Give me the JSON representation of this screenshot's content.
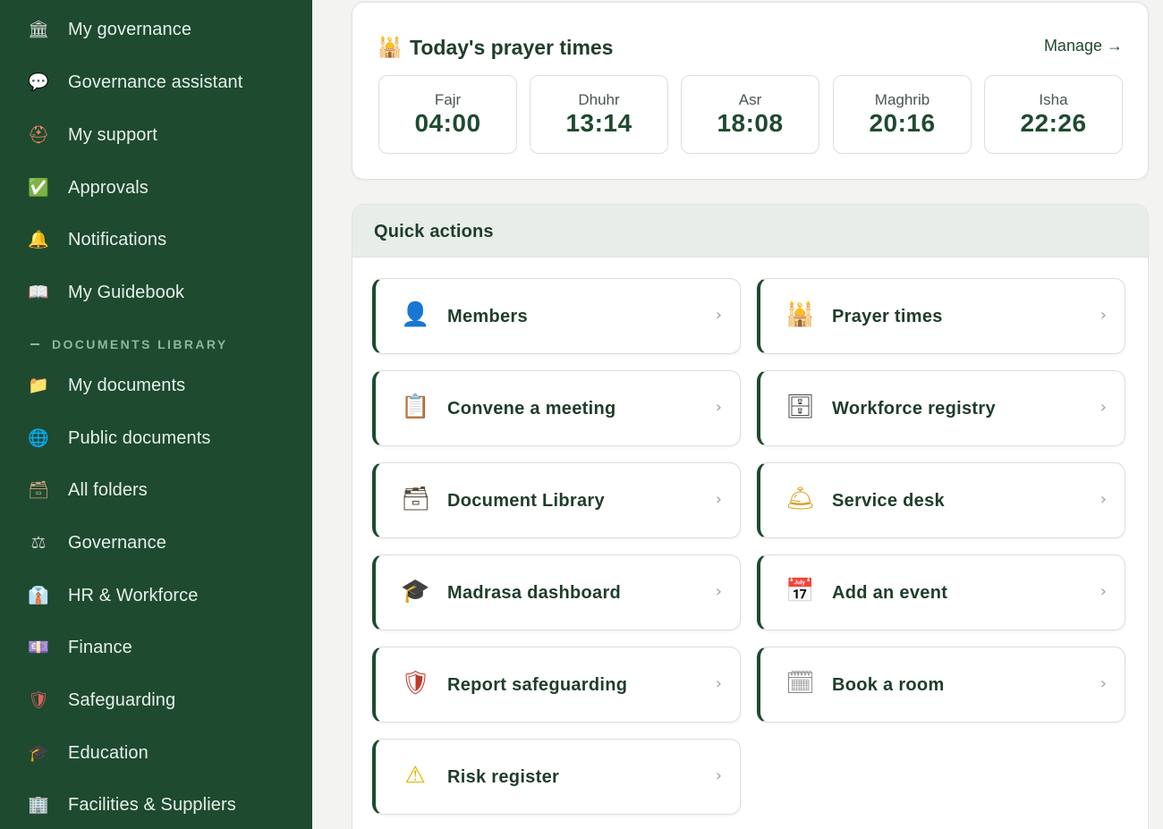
{
  "sidebar": {
    "items": [
      {
        "label": "My governance",
        "icon": "bank-icon",
        "glyph": "🏛",
        "color": "#d9d9d9"
      },
      {
        "label": "Governance assistant",
        "icon": "speech-bubble-icon",
        "glyph": "💬",
        "color": "#ffffff"
      },
      {
        "label": "My support",
        "icon": "lifebuoy-icon",
        "glyph": "⛑",
        "color": "#ff8a65"
      },
      {
        "label": "Approvals",
        "icon": "check-box-icon",
        "glyph": "✅",
        "color": "#2ec25b"
      },
      {
        "label": "Notifications",
        "icon": "bell-icon",
        "glyph": "🔔",
        "color": "#f4c542"
      },
      {
        "label": "My Guidebook",
        "icon": "open-book-icon",
        "glyph": "📖",
        "color": "#e8eef5"
      }
    ],
    "section_title": "DOCUMENTS LIBRARY",
    "doc_items": [
      {
        "label": "My documents",
        "icon": "folder-icon",
        "glyph": "📁",
        "color": "#c9c9c9"
      },
      {
        "label": "Public documents",
        "icon": "globe-icon",
        "glyph": "🌐",
        "color": "#7cb8e6"
      },
      {
        "label": "All folders",
        "icon": "card-index-icon",
        "glyph": "🗃",
        "color": "#c9a27a"
      },
      {
        "label": "Governance",
        "icon": "scales-icon",
        "glyph": "⚖",
        "color": "#c0c8c2"
      },
      {
        "label": "HR & Workforce",
        "icon": "briefcase-icon",
        "glyph": "👔",
        "color": "#7aa7e0"
      },
      {
        "label": "Finance",
        "icon": "banknote-icon",
        "glyph": "💷",
        "color": "#e0b4c8"
      },
      {
        "label": "Safeguarding",
        "icon": "shield-icon",
        "glyph": "🛡",
        "color": "#e06060"
      },
      {
        "label": "Education",
        "icon": "graduation-cap-icon",
        "glyph": "🎓",
        "color": "#d9a040"
      },
      {
        "label": "Facilities & Suppliers",
        "icon": "office-building-icon",
        "glyph": "🏢",
        "color": "#c0c4c8"
      }
    ]
  },
  "prayer": {
    "title": "Today's prayer times",
    "icon": "mosque-icon",
    "manage_label": "Manage →",
    "slots": [
      {
        "name": "Fajr",
        "time": "04:00"
      },
      {
        "name": "Dhuhr",
        "time": "13:14"
      },
      {
        "name": "Asr",
        "time": "18:08"
      },
      {
        "name": "Maghrib",
        "time": "20:16"
      },
      {
        "name": "Isha",
        "time": "22:26"
      }
    ]
  },
  "quick_actions": {
    "title": "Quick actions",
    "chevron": "›",
    "items": [
      {
        "label": "Members",
        "icon": "person-silhouette-icon",
        "glyph": "👤",
        "color": "#3d6e9e"
      },
      {
        "label": "Prayer times",
        "icon": "mosque-icon",
        "glyph": "🕌",
        "color": "#c8873a"
      },
      {
        "label": "Convene a meeting",
        "icon": "clipboard-icon",
        "glyph": "📋",
        "color": "#b08a5a"
      },
      {
        "label": "Workforce registry",
        "icon": "filing-tray-icon",
        "glyph": "🗄",
        "color": "#4a4a4a"
      },
      {
        "label": "Document Library",
        "icon": "card-file-box-icon",
        "glyph": "🗃",
        "color": "#5a4a3a"
      },
      {
        "label": "Service desk",
        "icon": "bellhop-bell-icon",
        "glyph": "🛎",
        "color": "#d9a020"
      },
      {
        "label": "Madrasa dashboard",
        "icon": "graduation-cap-icon",
        "glyph": "🎓",
        "color": "#222222"
      },
      {
        "label": "Add an event",
        "icon": "calendar-icon",
        "glyph": "📅",
        "color": "#c0392b"
      },
      {
        "label": "Report safeguarding",
        "icon": "shield-icon",
        "glyph": "🛡",
        "color": "#c0392b"
      },
      {
        "label": "Book a room",
        "icon": "spiral-calendar-icon",
        "glyph": "🗓",
        "color": "#888888"
      },
      {
        "label": "Risk register",
        "icon": "warning-icon",
        "glyph": "⚠",
        "color": "#e0b400"
      }
    ]
  },
  "colors": {
    "sidebar_bg": "#1e4a30",
    "accent": "#1e4a30",
    "section_title": "#8fb79d"
  }
}
